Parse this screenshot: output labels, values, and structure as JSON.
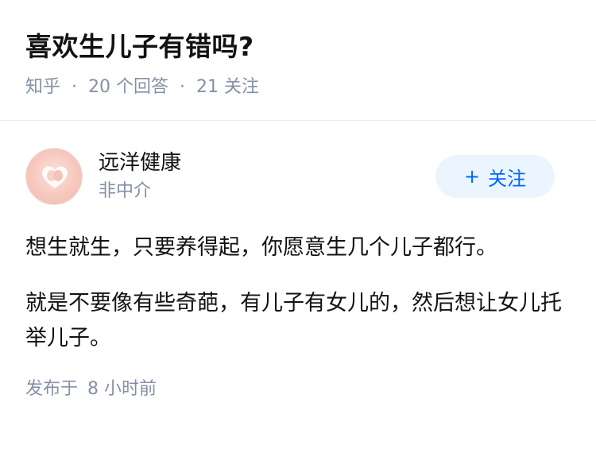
{
  "question": {
    "title": "喜欢生儿子有错吗?",
    "source": "知乎",
    "answer_count": "20 个回答",
    "follower_count": "21 关注"
  },
  "answer": {
    "author": {
      "name": "远洋健康",
      "role": "非中介",
      "avatar_icon": "heart-hands-icon"
    },
    "follow_button": {
      "icon": "+",
      "label": "关注"
    },
    "paragraphs": [
      "想生就生，只要养得起，你愿意生几个儿子都行。",
      "就是不要像有些奇葩，有儿子有女儿的，然后想让女儿托举儿子。"
    ],
    "footer": {
      "published_label": "发布于",
      "published_time": "8 小时前"
    }
  },
  "colors": {
    "accent": "#0066ff",
    "follow_bg": "#ebf5ff",
    "meta_gray": "#8590a6",
    "text": "#121212"
  }
}
